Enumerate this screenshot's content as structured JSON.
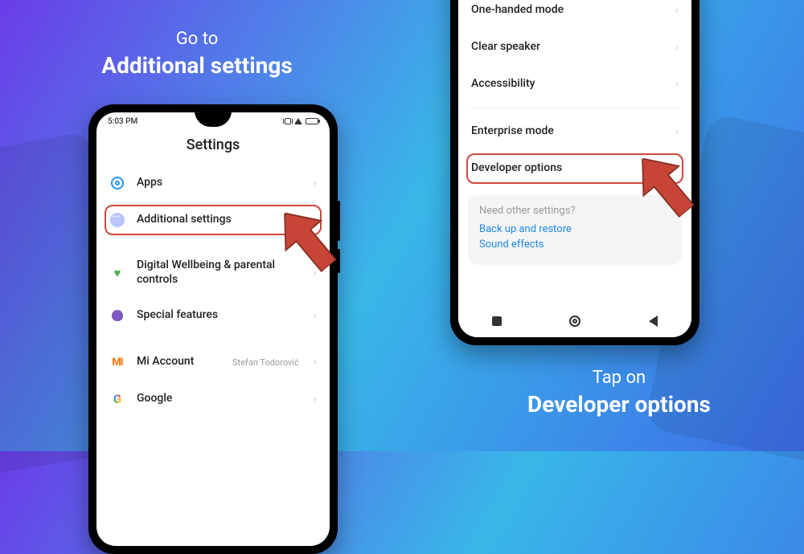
{
  "captions": {
    "left_small": "Go to",
    "left_big": "Additional settings",
    "right_small": "Tap on",
    "right_big": "Developer options"
  },
  "phone_left": {
    "time": "5:03 PM",
    "title": "Settings",
    "rows": {
      "apps": "Apps",
      "additional": "Additional settings",
      "wellbeing": "Digital Wellbeing & parental controls",
      "special": "Special features",
      "mi_account": "Mi Account",
      "mi_account_value": "Stefan Todorović",
      "google": "Google"
    }
  },
  "phone_right": {
    "rows": {
      "one_handed": "One-handed mode",
      "clear_speaker": "Clear speaker",
      "accessibility": "Accessibility",
      "enterprise": "Enterprise mode",
      "developer": "Developer options"
    },
    "footer": {
      "question": "Need other settings?",
      "link1": "Back up and restore",
      "link2": "Sound effects"
    }
  }
}
